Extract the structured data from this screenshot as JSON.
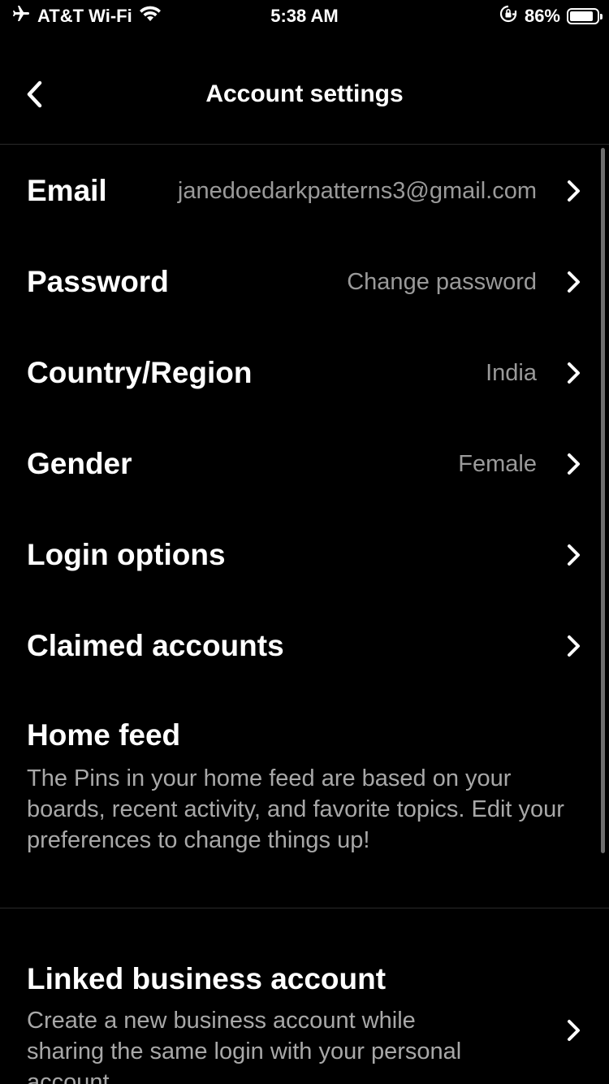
{
  "status_bar": {
    "carrier": "AT&T Wi-Fi",
    "time": "5:38 AM",
    "battery_percent": "86%",
    "battery_level": 0.86,
    "icons": [
      "airplane-icon",
      "wifi-icon",
      "orientation-lock-icon",
      "battery-icon"
    ]
  },
  "header": {
    "title": "Account settings",
    "back_icon": "chevron-left-icon"
  },
  "rows": [
    {
      "label": "Email",
      "value": "janedoedarkpatterns3@gmail.com"
    },
    {
      "label": "Password",
      "value": "Change password"
    },
    {
      "label": "Country/Region",
      "value": "India"
    },
    {
      "label": "Gender",
      "value": "Female"
    },
    {
      "label": "Login options",
      "value": ""
    },
    {
      "label": "Claimed accounts",
      "value": ""
    }
  ],
  "home_feed": {
    "title": "Home feed",
    "description": "The Pins in your home feed are based on your boards, recent activity, and favorite topics. Edit your preferences to change things up!"
  },
  "linked_business": {
    "title": "Linked business account",
    "description": "Create a new business account while sharing the same login with your personal account."
  },
  "colors": {
    "background": "#000000",
    "primary_text": "#ffffff",
    "secondary_text": "#9a9a9a",
    "divider": "#2a2a2a"
  }
}
